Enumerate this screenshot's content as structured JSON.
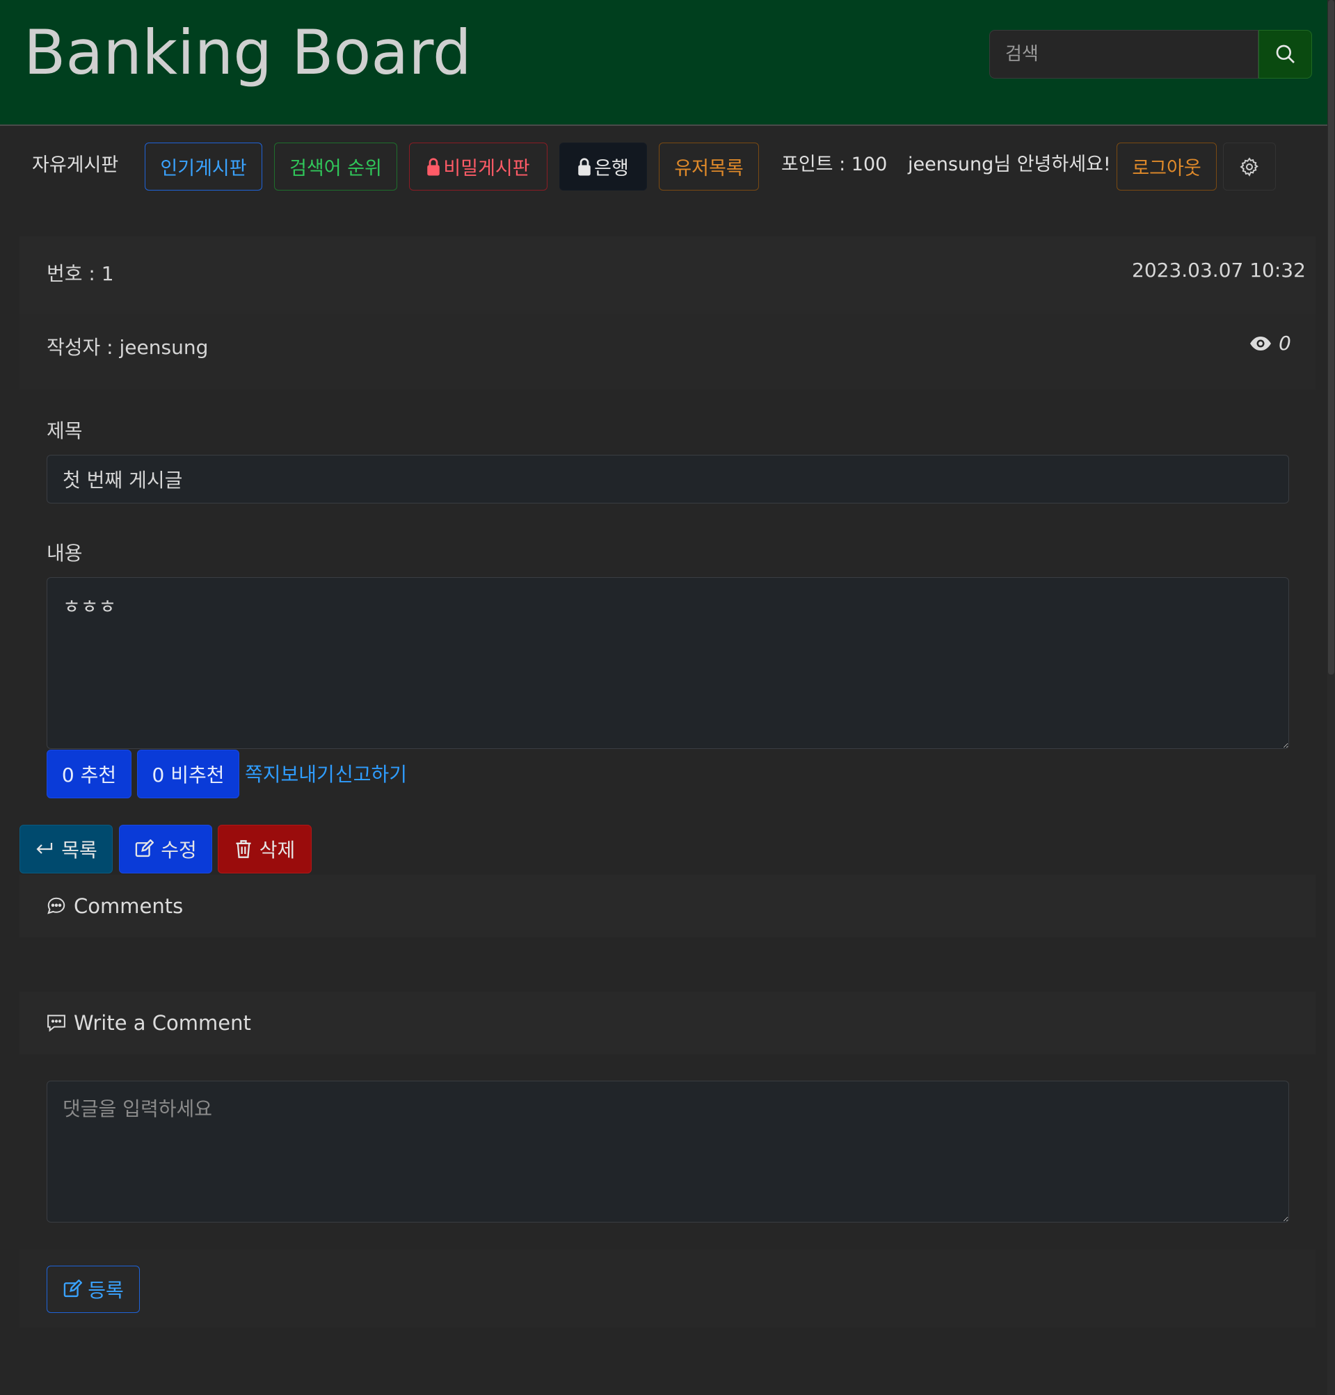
{
  "header": {
    "brand": "Banking Board",
    "search_placeholder": "검색"
  },
  "nav": {
    "free_board": "자유게시판",
    "popular_board": "인기게시판",
    "search_rank": "검색어 순위",
    "secret_board": "비밀게시판",
    "bank": "은행",
    "user_list": "유저목록",
    "points": "포인트 : 100",
    "greeting": "jeensung님 안녕하세요!",
    "logout": "로그아웃"
  },
  "post": {
    "number": "번호 : 1",
    "date": "2023.03.07 10:32",
    "author": "작성자 : jeensung",
    "views": "0",
    "title_label": "제목",
    "title_value": "첫 번째 게시글",
    "content_label": "내용",
    "content_value": "ㅎㅎㅎ"
  },
  "votes": {
    "up": "0 추천",
    "down": "0 비추천"
  },
  "links": {
    "message": "쪽지보내기",
    "report": "신고하기"
  },
  "actions": {
    "list": "목록",
    "edit": "수정",
    "delete": "삭제"
  },
  "comments": {
    "title": "Comments",
    "write_title": "Write a Comment",
    "placeholder": "댓글을 입력하세요",
    "submit": "등록"
  },
  "colors": {
    "header_bg": "#003f1e",
    "page_bg": "#262626",
    "primary": "#0a3bd8",
    "danger": "#9a0c0c",
    "link": "#2f9dff"
  }
}
